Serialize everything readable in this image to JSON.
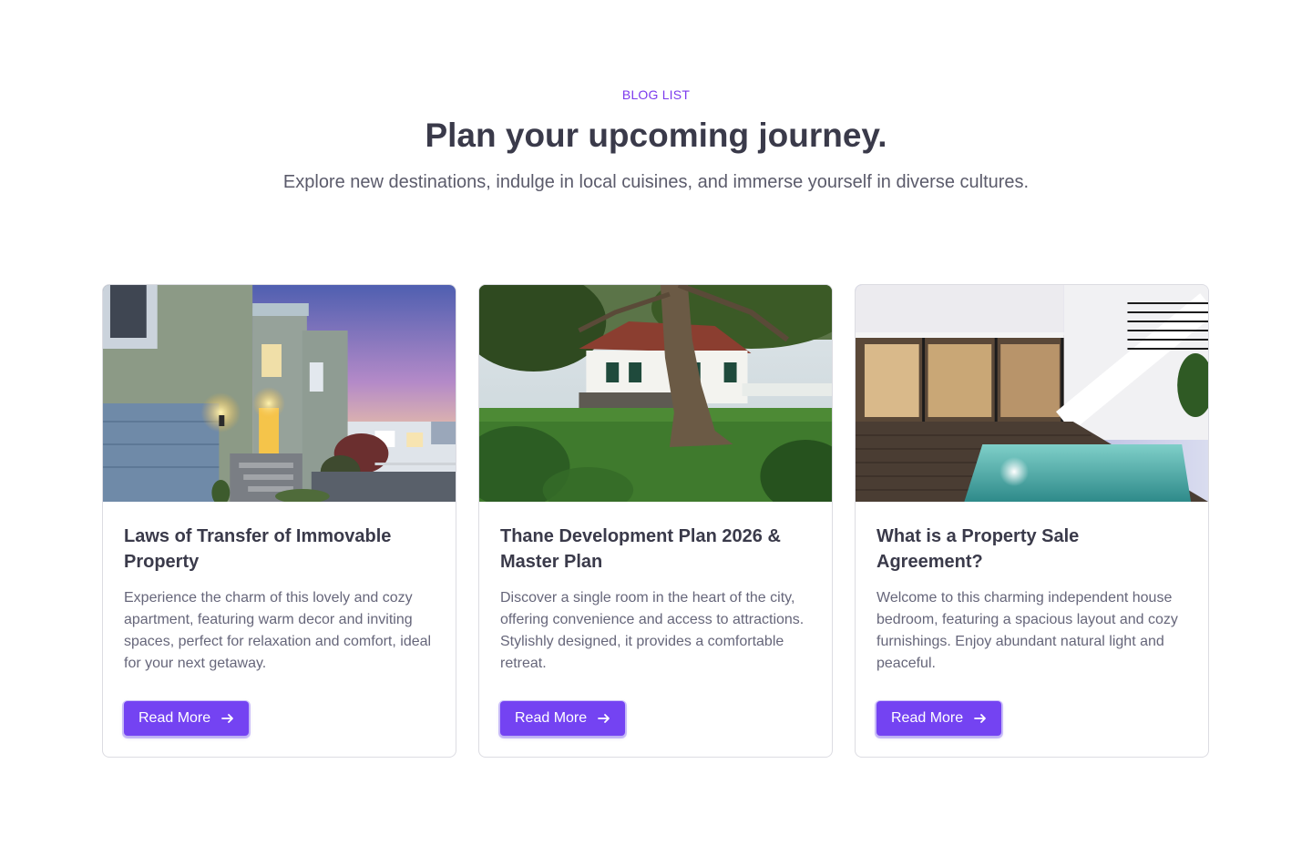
{
  "header": {
    "eyebrow": "BLOG LIST",
    "title": "Plan your upcoming journey.",
    "subtitle": "Explore new destinations, indulge in local cuisines, and immerse yourself in diverse cultures."
  },
  "posts": [
    {
      "title": "Laws of Transfer of Immovable Property",
      "excerpt": "Experience the charm of this lovely and cozy apartment, featuring warm decor and inviting spaces, perfect for relaxation and comfort, ideal for your next getaway.",
      "cta": "Read More",
      "image": "house-exterior-at-dusk"
    },
    {
      "title": "Thane Development Plan 2026 & Master Plan",
      "excerpt": "Discover a single room in the heart of the city, offering convenience and access to attractions. Stylishly designed, it provides a comfortable retreat.",
      "cta": "Read More",
      "image": "white-house-with-tree"
    },
    {
      "title": "What is a Property Sale Agreement?",
      "excerpt": "Welcome to this charming independent house bedroom, featuring a spacious layout and cozy furnishings. Enjoy abundant natural light and peaceful.",
      "cta": "Read More",
      "image": "modern-house-with-pool"
    }
  ],
  "colors": {
    "accent": "#7443f2",
    "eyebrow": "#7c3aed",
    "heading": "#3a3a4a",
    "body": "#66667a",
    "border": "#dcdce2"
  },
  "icons": {
    "cta": "arrow-right-icon"
  }
}
